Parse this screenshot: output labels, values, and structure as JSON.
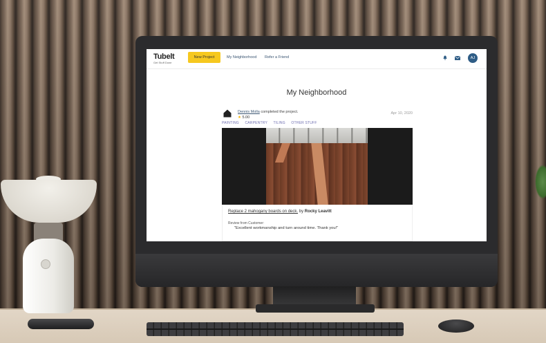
{
  "app": {
    "logo_text": "Tu",
    "logo_text_b": "belt",
    "tagline": "Get Stuff Done",
    "new_project_label": "New Project",
    "nav": [
      "My Neighborhood",
      "Refer a Friend"
    ],
    "avatar_initials": "AJ",
    "accent_color": "#f6c81f",
    "avatar_color": "#2f5d86"
  },
  "page": {
    "title": "My Neighborhood"
  },
  "post": {
    "user": "Dennis Molla",
    "action": "completed the project.",
    "rating": "5.00",
    "date": "Apr 10, 2020",
    "tags": [
      "PAINTING",
      "CARPENTRY",
      "TILING",
      "OTHER STUFF"
    ],
    "job_title": "Replace 2 mahogany boards on deck.",
    "by_prefix": "by",
    "by_name": "Rocky Leavitt",
    "review_label": "Review from Customer:",
    "review_text": "\"Excellent workmanship and turn around time. Thank you!\""
  },
  "icons": {
    "bell": "bell-icon",
    "mail": "mail-icon",
    "star": "star-icon",
    "house": "house-icon"
  }
}
